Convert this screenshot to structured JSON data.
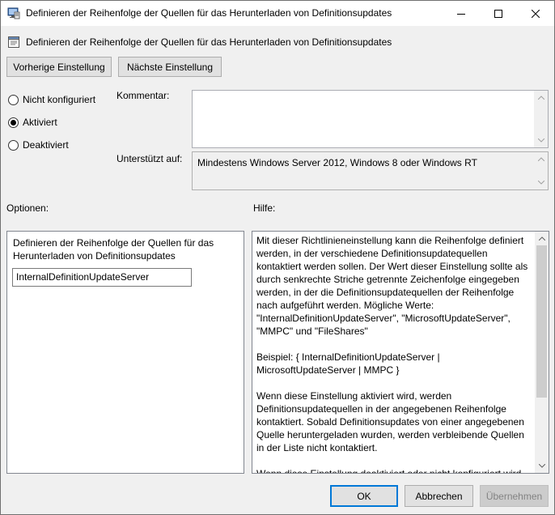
{
  "window": {
    "title": "Definieren der Reihenfolge der Quellen für das Herunterladen von Definitionsupdates",
    "header": "Definieren der Reihenfolge der Quellen für das Herunterladen von Definitionsupdates"
  },
  "nav": {
    "previous_label": "Vorherige Einstellung",
    "next_label": "Nächste Einstellung"
  },
  "state": {
    "options": [
      {
        "label": "Nicht konfiguriert",
        "selected": false
      },
      {
        "label": "Aktiviert",
        "selected": true
      },
      {
        "label": "Deaktiviert",
        "selected": false
      }
    ]
  },
  "comment": {
    "label": "Kommentar:",
    "value": ""
  },
  "supported": {
    "label": "Unterstützt auf:",
    "value": "Mindestens Windows Server 2012, Windows 8 oder Windows RT"
  },
  "options_pane": {
    "label": "Optionen:",
    "field_label": "Definieren der Reihenfolge der Quellen für das Herunterladen von Definitionsupdates",
    "field_value": "InternalDefinitionUpdateServer"
  },
  "help_pane": {
    "label": "Hilfe:",
    "paragraphs": [
      "Mit dieser Richtlinieneinstellung kann die Reihenfolge definiert werden, in der verschiedene Definitionsupdatequellen kontaktiert werden sollen. Der Wert dieser Einstellung sollte als durch senkrechte Striche getrennte Zeichenfolge eingegeben werden, in der die Definitionsupdatequellen der Reihenfolge nach aufgeführt werden. Mögliche Werte: \"InternalDefinitionUpdateServer\", \"MicrosoftUpdateServer\", \"MMPC\" und \"FileShares\"",
      "Beispiel: { InternalDefinitionUpdateServer | MicrosoftUpdateServer | MMPC }",
      "Wenn diese Einstellung aktiviert wird, werden Definitionsupdatequellen in der angegebenen Reihenfolge kontaktiert. Sobald Definitionsupdates von einer angegebenen Quelle heruntergeladen wurden, werden verbleibende Quellen in der Liste nicht kontaktiert.",
      "Wenn diese Einstellung deaktiviert oder nicht konfiguriert wird,"
    ]
  },
  "footer": {
    "ok_label": "OK",
    "cancel_label": "Abbrechen",
    "apply_label": "Übernehmen"
  },
  "icons": {
    "title": "policy-settings-icon",
    "header": "policy-page-icon",
    "minimize": "minimize-icon",
    "maximize": "maximize-icon",
    "close": "close-icon"
  },
  "colors": {
    "accent": "#0078d7",
    "window_bg": "#f0f0f0",
    "border": "#adadad"
  }
}
